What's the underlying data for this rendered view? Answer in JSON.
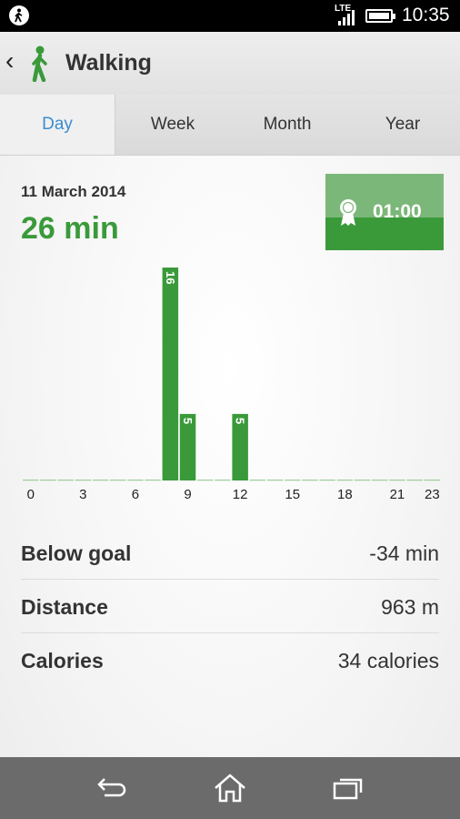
{
  "status_bar": {
    "network": "LTE",
    "time": "10:35"
  },
  "header": {
    "title": "Walking",
    "back_icon": "chevron-left-icon",
    "activity_icon": "walking-person-icon"
  },
  "tabs": [
    {
      "label": "Day",
      "active": true
    },
    {
      "label": "Week",
      "active": false
    },
    {
      "label": "Month",
      "active": false
    },
    {
      "label": "Year",
      "active": false
    }
  ],
  "summary": {
    "date": "11 March 2014",
    "total": "26 min"
  },
  "goal": {
    "time": "01:00",
    "icon": "award-ribbon-icon"
  },
  "colors": {
    "accent_green": "#3a9a3a",
    "light_green": "#7cb77a",
    "tab_active": "#3a8cd0"
  },
  "chart_data": {
    "type": "bar",
    "x": [
      0,
      1,
      2,
      3,
      4,
      5,
      6,
      7,
      8,
      9,
      10,
      11,
      12,
      13,
      14,
      15,
      16,
      17,
      18,
      19,
      20,
      21,
      22,
      23
    ],
    "values": [
      0,
      0,
      0,
      0,
      0,
      0,
      0,
      0,
      16,
      5,
      0,
      0,
      5,
      0,
      0,
      0,
      0,
      0,
      0,
      0,
      0,
      0,
      0,
      0
    ],
    "tick_labels": [
      "0",
      "3",
      "6",
      "9",
      "12",
      "15",
      "18",
      "21",
      "23"
    ],
    "tick_positions": [
      0,
      3,
      6,
      9,
      12,
      15,
      18,
      21,
      23
    ],
    "data_labels": [
      "16",
      "5",
      "5"
    ],
    "ylim": [
      0,
      16
    ]
  },
  "stats": [
    {
      "label": "Below goal",
      "value": "-34 min"
    },
    {
      "label": "Distance",
      "value": "963 m"
    },
    {
      "label": "Calories",
      "value": "34 calories"
    }
  ],
  "nav": {
    "back": "back-icon",
    "home": "home-icon",
    "recents": "recents-icon"
  }
}
